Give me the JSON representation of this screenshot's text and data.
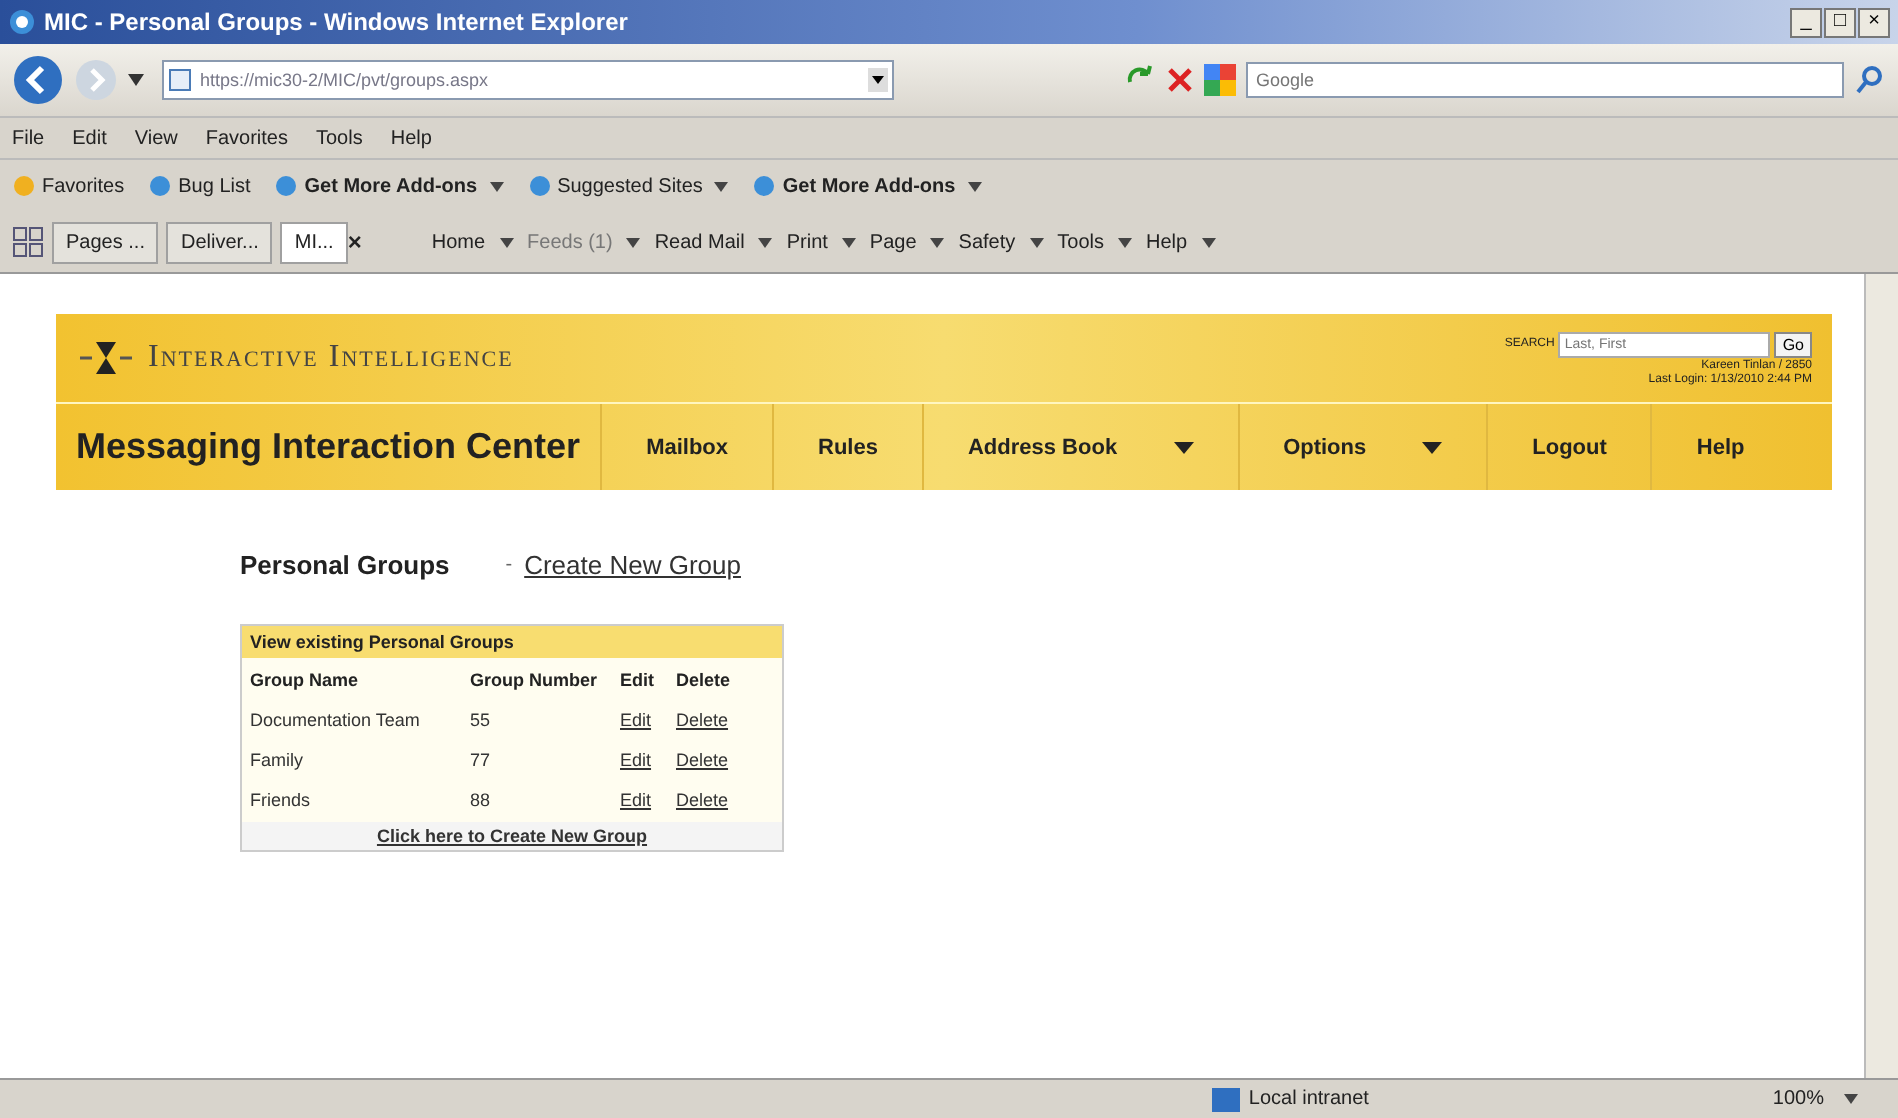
{
  "window": {
    "title": "MIC - Personal Groups - Windows Internet Explorer",
    "buttons": [
      "_",
      "□",
      "×"
    ]
  },
  "address_bar": {
    "url": "https://mic30-2/MIC/pvt/groups.aspx",
    "search_placeholder": "Google"
  },
  "menu_bar": [
    "File",
    "Edit",
    "View",
    "Favorites",
    "Tools",
    "Help"
  ],
  "favorites_bar": [
    {
      "label": "Favorites",
      "bold": false,
      "dropdown": false
    },
    {
      "label": "Bug List",
      "bold": false,
      "dropdown": false
    },
    {
      "label": "Get More Add-ons",
      "bold": true,
      "dropdown": true
    },
    {
      "label": "Suggested Sites",
      "bold": false,
      "dropdown": true
    },
    {
      "label": "Get More Add-ons",
      "bold": true,
      "dropdown": true
    }
  ],
  "tabs": [
    {
      "label": "Pages ...",
      "selected": false
    },
    {
      "label": "Deliver...",
      "selected": false
    },
    {
      "label": "MI...",
      "selected": true
    }
  ],
  "tab_close": "×",
  "command_bar": [
    {
      "label": "Home",
      "disabled": false
    },
    {
      "label": "Feeds (1)",
      "disabled": true
    },
    {
      "label": "Read Mail",
      "disabled": false
    },
    {
      "label": "Print",
      "disabled": false
    },
    {
      "label": "Page",
      "disabled": false
    },
    {
      "label": "Safety",
      "disabled": false
    },
    {
      "label": "Tools",
      "disabled": false
    },
    {
      "label": "Help",
      "disabled": false
    }
  ],
  "site": {
    "logo_text": "Interactive Intelligence",
    "search_label": "SEARCH",
    "search_placeholder": "Last, First",
    "go": "Go",
    "user": "Kareen Tinlan / 2850",
    "last_login": "Last Login: 1/13/2010 2:44 PM",
    "app_title": "Messaging Interaction Center",
    "nav": [
      {
        "label": "Mailbox",
        "dropdown": false
      },
      {
        "label": "Rules",
        "dropdown": false
      },
      {
        "label": "Address Book",
        "dropdown": true
      },
      {
        "label": "Options",
        "dropdown": true
      },
      {
        "label": "Logout",
        "dropdown": false
      },
      {
        "label": "Help",
        "dropdown": false
      }
    ]
  },
  "page": {
    "heading": "Personal Groups",
    "bullet": "-",
    "create_link": "Create New Group",
    "table": {
      "caption": "View existing Personal Groups",
      "columns": [
        "Group Name",
        "Group Number",
        "Edit",
        "Delete"
      ],
      "rows": [
        {
          "name": "Documentation Team",
          "number": "55",
          "edit": "Edit",
          "delete": "Delete"
        },
        {
          "name": "Family",
          "number": "77",
          "edit": "Edit",
          "delete": "Delete"
        },
        {
          "name": "Friends",
          "number": "88",
          "edit": "Edit",
          "delete": "Delete"
        }
      ],
      "footer_link": "Click here to Create New Group"
    }
  },
  "status_bar": {
    "zone": "Local intranet",
    "zoom": "100%"
  }
}
